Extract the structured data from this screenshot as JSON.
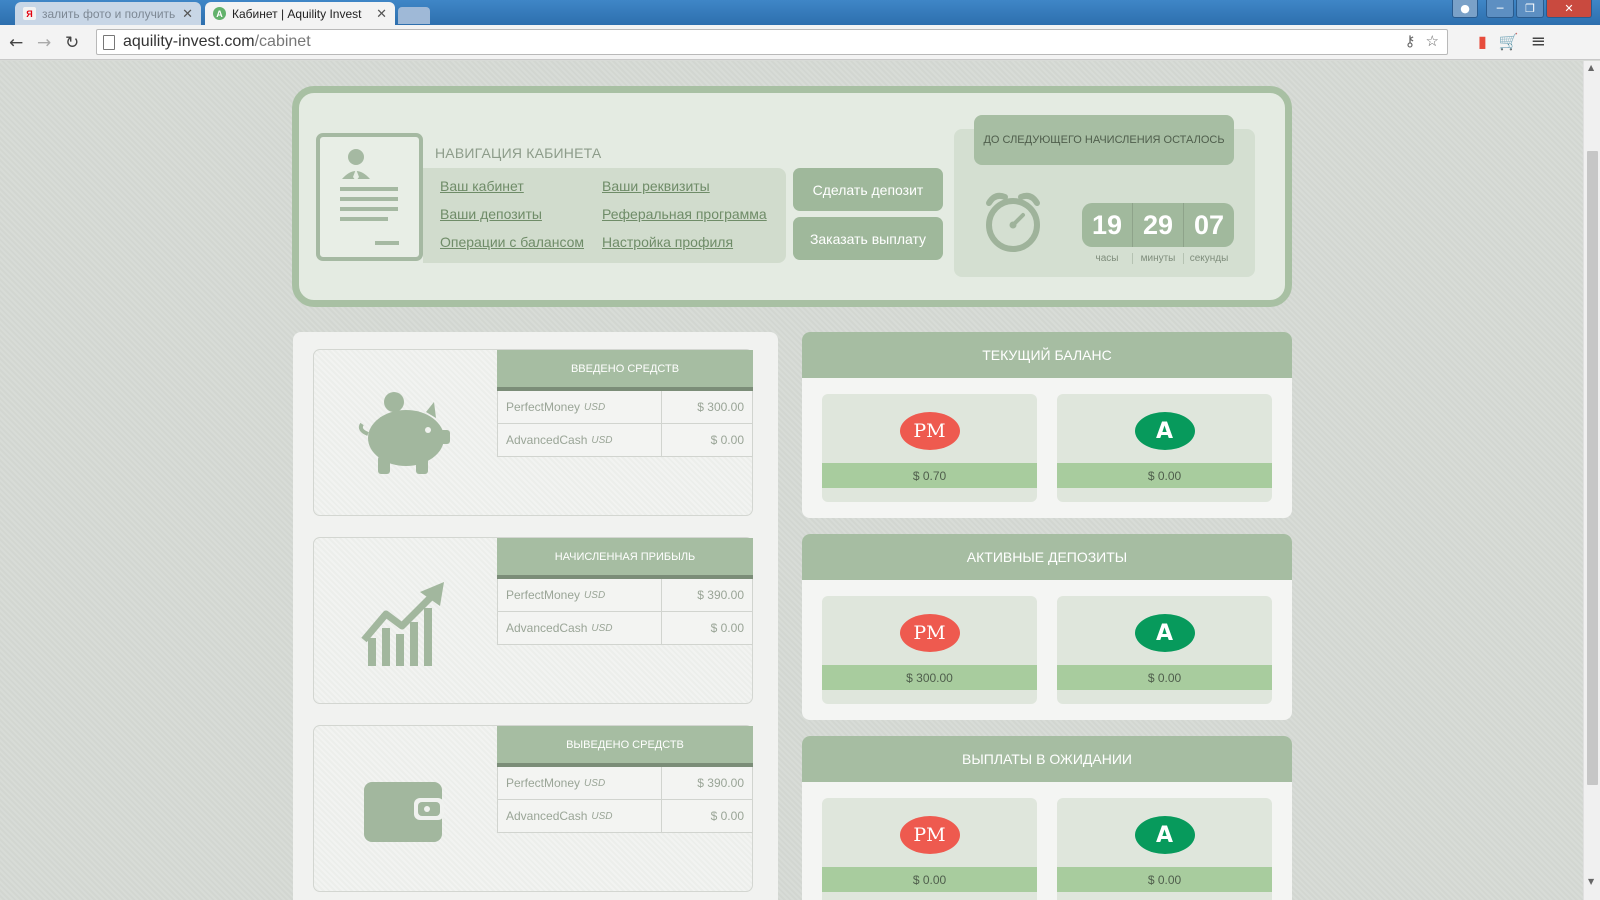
{
  "browser": {
    "tabs": [
      {
        "title": "залить фото и получить с",
        "favicon": "Я"
      },
      {
        "title": "Кабинет | Aquility Invest",
        "favicon": "A"
      }
    ],
    "url_host": "aquility-invest.com",
    "url_path": "/cabinet"
  },
  "nav": {
    "heading": "НАВИГАЦИЯ КАБИНЕТА",
    "links": {
      "cabinet": "Ваш кабинет",
      "requisites": "Ваши реквизиты",
      "deposits": "Ваши депозиты",
      "referral": "Реферальная программа",
      "balance_ops": "Операции с балансом",
      "profile": "Настройка профиля"
    },
    "buttons": {
      "make_deposit": "Сделать депозит",
      "withdraw": "Заказать выплату"
    }
  },
  "timer": {
    "header": "ДО СЛЕДУЮЩЕГО НАЧИСЛЕНИЯ ОСТАЛОСЬ",
    "hours": "19",
    "minutes": "29",
    "seconds": "07",
    "hours_label": "часы",
    "minutes_label": "минуты",
    "seconds_label": "секунды"
  },
  "stats": {
    "deposited": {
      "title": "ВВЕДЕНО СРЕДСТВ",
      "pm_name": "PerfectMoney",
      "pm_cur": "USD",
      "pm_amount": "$ 300.00",
      "ac_name": "AdvancedCash",
      "ac_cur": "USD",
      "ac_amount": "$ 0.00"
    },
    "profit": {
      "title": "НАЧИСЛЕННАЯ ПРИБЫЛЬ",
      "pm_name": "PerfectMoney",
      "pm_cur": "USD",
      "pm_amount": "$ 390.00",
      "ac_name": "AdvancedCash",
      "ac_cur": "USD",
      "ac_amount": "$ 0.00"
    },
    "withdrawn": {
      "title": "ВЫВЕДЕНО СРЕДСТВ",
      "pm_name": "PerfectMoney",
      "pm_cur": "USD",
      "pm_amount": "$ 390.00",
      "ac_name": "AdvancedCash",
      "ac_cur": "USD",
      "ac_amount": "$ 0.00"
    }
  },
  "balances": {
    "current": {
      "title": "ТЕКУЩИЙ БАЛАНС",
      "pm": "$ 0.70",
      "ac": "$ 0.00"
    },
    "active": {
      "title": "АКТИВНЫЕ ДЕПОЗИТЫ",
      "pm": "$ 300.00",
      "ac": "$ 0.00"
    },
    "pending": {
      "title": "ВЫПЛАТЫ В ОЖИДАНИИ",
      "pm": "$ 0.00",
      "ac": "$ 0.00"
    }
  },
  "logos": {
    "pm": "PM",
    "ac": "A"
  },
  "colors": {
    "accent": "#a6bda2",
    "pm_red": "#ee5a4f",
    "ac_green": "#079a5c",
    "amount_bar": "#a8cc9e"
  }
}
